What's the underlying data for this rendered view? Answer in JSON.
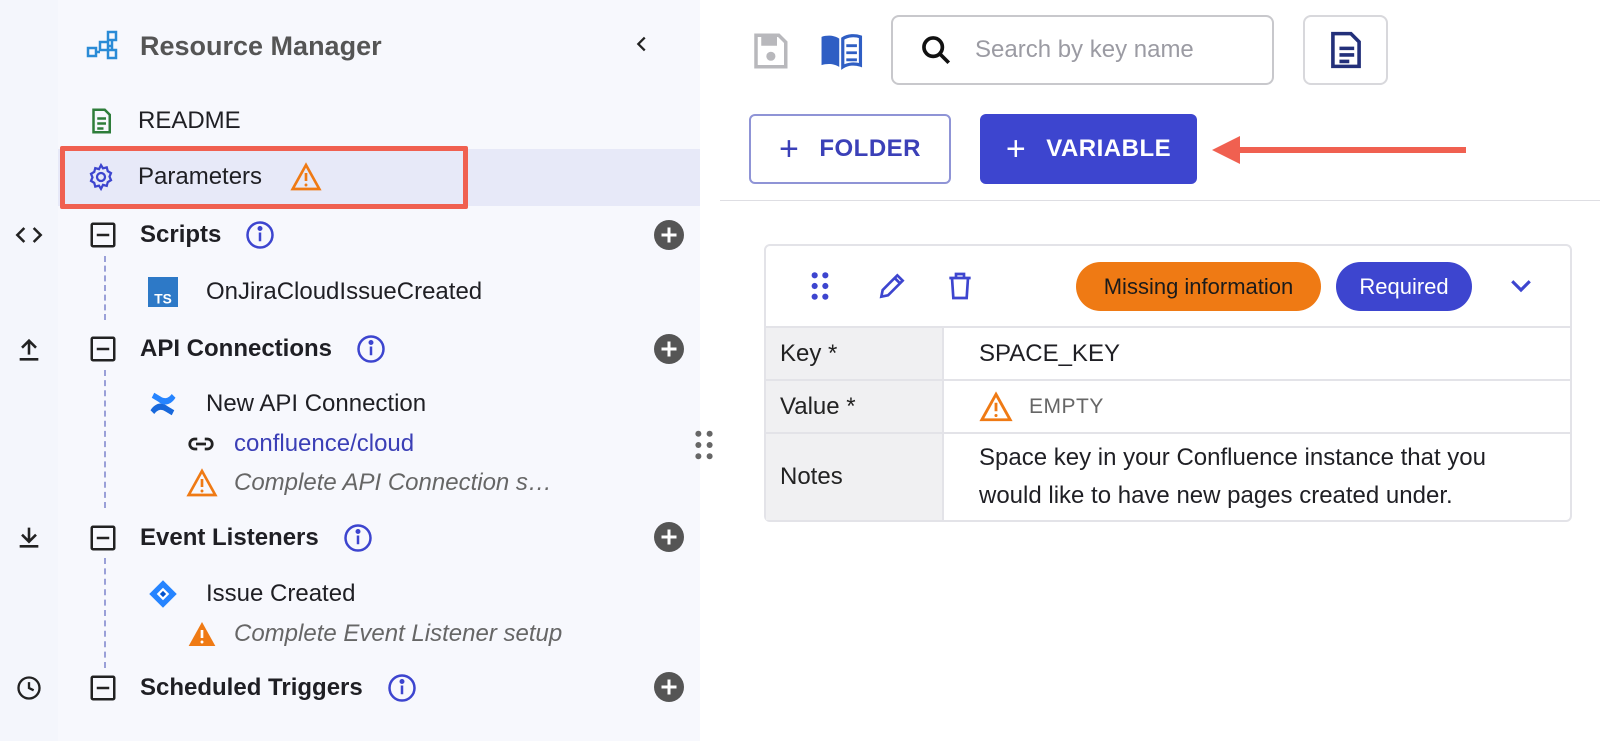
{
  "app": {
    "title": "Resource Manager"
  },
  "sidebar": {
    "readme": "README",
    "parameters": "Parameters",
    "sections": {
      "scripts": {
        "label": "Scripts",
        "items": [
          "OnJiraCloudIssueCreated"
        ]
      },
      "api_connections": {
        "label": "API Connections",
        "item": "New API Connection",
        "link": "confluence/cloud",
        "warning": "Complete API Connection s…"
      },
      "event_listeners": {
        "label": "Event Listeners",
        "item": "Issue Created",
        "warning": "Complete Event Listener setup"
      },
      "scheduled_triggers": {
        "label": "Scheduled Triggers"
      }
    }
  },
  "toolbar": {
    "search_placeholder": "Search by key name",
    "folder_label": "FOLDER",
    "variable_label": "VARIABLE"
  },
  "card": {
    "badge_missing": "Missing information",
    "badge_required": "Required",
    "key_label": "Key *",
    "key_value": "SPACE_KEY",
    "value_label": "Value *",
    "value_value": "EMPTY",
    "notes_label": "Notes",
    "notes_value": "Space key in your Confluence instance that you would like to have new pages created under."
  },
  "colors": {
    "accent": "#3d45cf",
    "warning": "#ef7a14",
    "highlight_box": "#f06050",
    "selected_row": "#e7e9f8"
  }
}
